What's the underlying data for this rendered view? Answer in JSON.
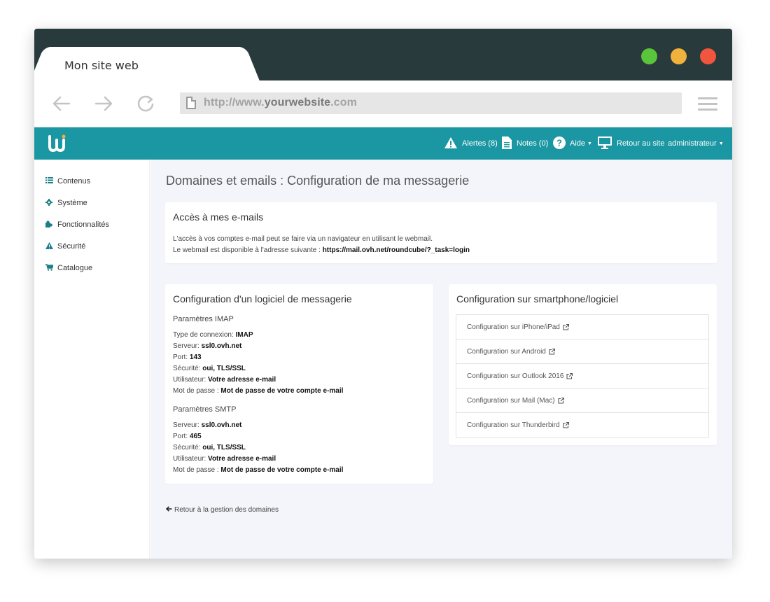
{
  "browser": {
    "tab_title": "Mon site web",
    "url_prefix": "http://www.",
    "url_domain": "yourwebsite",
    "url_suffix": ".com",
    "window_controls": [
      "#5ac43a",
      "#f0b23d",
      "#f0553d"
    ]
  },
  "appbar": {
    "color": "#1a97a2",
    "alerts": "Alertes (8)",
    "notes": "Notes (0)",
    "help": "Aide",
    "back_to_site": "Retour au site",
    "user": "administrateur"
  },
  "sidebar": {
    "items": [
      {
        "label": "Contenus",
        "icon": "list-icon"
      },
      {
        "label": "Système",
        "icon": "gear-icon"
      },
      {
        "label": "Fonctionnalités",
        "icon": "puzzle-icon"
      },
      {
        "label": "Sécurité",
        "icon": "warning-icon"
      },
      {
        "label": "Catalogue",
        "icon": "cart-icon"
      }
    ]
  },
  "main": {
    "page_title": "Domaines et emails : Configuration de ma messagerie",
    "access_card": {
      "title": "Accès à mes e-mails",
      "line1": "L'accès à vos comptes e-mail peut se faire via un navigateur en utilisant le webmail.",
      "line2_label": "Le webmail est disponible à l'adresse suivante : ",
      "line2_value": "https://mail.ovh.net/roundcube/?_task=login"
    },
    "software_card": {
      "title": "Configuration d'un logiciel de messagerie",
      "imap": {
        "heading": "Paramètres IMAP",
        "rows": [
          {
            "label": "Type de connexion: ",
            "value": "IMAP"
          },
          {
            "label": "Serveur: ",
            "value": "ssl0.ovh.net"
          },
          {
            "label": "Port: ",
            "value": "143"
          },
          {
            "label": "Sécurité: ",
            "value": "oui, TLS/SSL"
          },
          {
            "label": "Utilisateur: ",
            "value": "Votre adresse e-mail"
          },
          {
            "label": "Mot de passe : ",
            "value": "Mot de passe de votre compte e-mail"
          }
        ]
      },
      "smtp": {
        "heading": "Paramètres SMTP",
        "rows": [
          {
            "label": "Serveur: ",
            "value": "ssl0.ovh.net"
          },
          {
            "label": "Port: ",
            "value": "465"
          },
          {
            "label": "Sécurité: ",
            "value": "oui, TLS/SSL"
          },
          {
            "label": "Utilisateur: ",
            "value": "Votre adresse e-mail"
          },
          {
            "label": "Mot de passe : ",
            "value": "Mot de passe de votre compte e-mail"
          }
        ]
      }
    },
    "smartphone_card": {
      "title": "Configuration sur smartphone/logiciel",
      "links": [
        "Configuration sur iPhone/iPad",
        "Configuration sur Android",
        "Configuration sur Outlook 2016",
        "Configuration sur Mail (Mac)",
        "Configuration sur Thunderbird"
      ]
    },
    "back_link": "Retour à la gestion des domaines"
  }
}
